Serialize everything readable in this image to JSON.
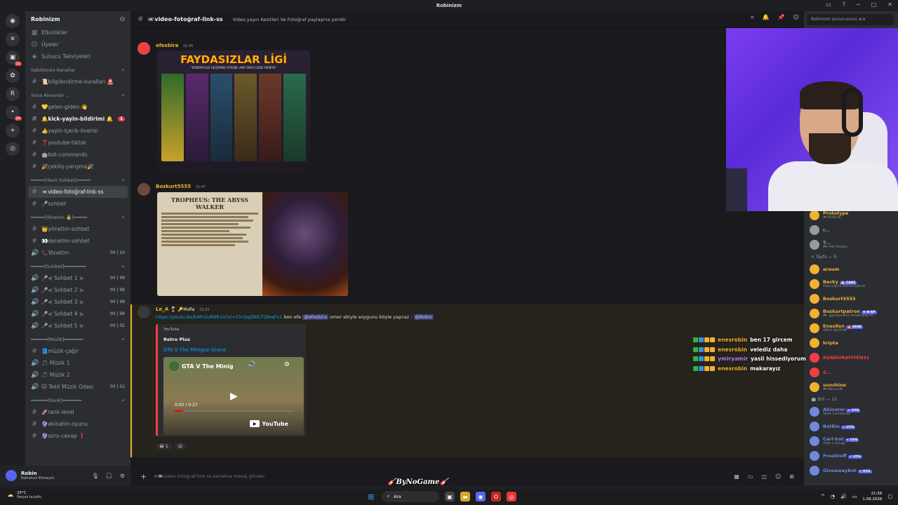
{
  "window": {
    "title": "Robinizm"
  },
  "servers": [
    {
      "icon": "discord-home-icon",
      "glyph": "◉"
    },
    {
      "icon": "server-x-icon",
      "glyph": "✕",
      "badge": ""
    },
    {
      "icon": "server-1-icon",
      "glyph": "▣",
      "badge": "11"
    },
    {
      "icon": "server-2-icon",
      "glyph": "✿",
      "badge": ""
    },
    {
      "icon": "server-robinizm-icon",
      "glyph": "R",
      "badge": ""
    },
    {
      "icon": "server-3-icon",
      "glyph": "•",
      "badge": "24"
    },
    {
      "icon": "add-server-icon",
      "glyph": "+"
    },
    {
      "icon": "explore-icon",
      "glyph": "◎"
    }
  ],
  "guild": {
    "name": "Robinizm",
    "chevron": "⌄"
  },
  "channel_top": [
    {
      "label": "Etkinlikler",
      "icon": "calendar-icon",
      "glyph": "▦"
    },
    {
      "label": "Üyeler",
      "icon": "members-icon",
      "glyph": "☺"
    },
    {
      "label": "Sunucu Takviyeleri",
      "icon": "boost-icon",
      "glyph": "◈"
    }
  ],
  "categories": {
    "pinned": "Sabitlenen Kanallar",
    "recent": "Sona Alınanlar ⌄",
    "text": "━━━━━[Yazılı Sohbet]━━━━━",
    "admin": "━━━━━[Yönetim 🔒]━━━━━",
    "chat": "━━━━━[Sohbet]━━━━━━━━",
    "music": "━━━━━━[Müzik]━━━━━━━",
    "rank": "━━━━━━[Rank]━━━━━━━"
  },
  "channels": {
    "pinned": [
      {
        "label": "📜bilgilendirme-kuralları 🚨",
        "type": "#"
      }
    ],
    "recent": [
      {
        "label": "💛gelen-giden-👋",
        "type": "#"
      },
      {
        "label": "🔔kick-yayin-bildirimi 🔔",
        "type": "#",
        "bold": true,
        "badge": "1"
      },
      {
        "label": "👍yayin-içerik-önerisi",
        "type": "#"
      },
      {
        "label": "❓youtube-tiktok",
        "type": "#"
      },
      {
        "label": "🤖bot-commands",
        "type": "#"
      },
      {
        "label": "🎉çekiliş-yarışma🎉",
        "type": "#"
      }
    ],
    "text": [
      {
        "label": "📼video-fotoğraf-link-ss",
        "type": "#",
        "active": true
      },
      {
        "label": "🎤sohbet",
        "type": "#"
      }
    ],
    "admin": [
      {
        "label": "👑yönetim-sohbet",
        "type": "#"
      },
      {
        "label": "👀denetim-sohbet",
        "type": "#"
      },
      {
        "label": "📞Yönetim",
        "type": "🔊",
        "rt": "00 | 10"
      }
    ],
    "chat": [
      {
        "label": "🎤⋞ Sohbet 1 ⋟",
        "type": "🔊",
        "rt": "00 | 99"
      },
      {
        "label": "🎤⋞ Sohbet 2 ⋟",
        "type": "🔊",
        "rt": "00 | 99"
      },
      {
        "label": "🎤⋞ Sohbet 3 ⋟",
        "type": "🔊",
        "rt": "00 | 99"
      },
      {
        "label": "🎤⋞ Sohbet 4 ⋟",
        "type": "🔊",
        "rt": "00 | 99"
      },
      {
        "label": "🎤⋞ Sohbet 5 ⋟",
        "type": "🔊",
        "rt": "00 | 02"
      }
    ],
    "music": [
      {
        "label": "📘müzik-çağır",
        "type": "#"
      },
      {
        "label": "🎵 Müzik 1",
        "type": "🔊"
      },
      {
        "label": "🎵 Müzik 2",
        "type": "🔊"
      },
      {
        "label": "🐱 Tekli Müzik Odası",
        "type": "🔊",
        "rt": "00 | 01"
      }
    ],
    "rank": [
      {
        "label": "🚀rank-level",
        "type": "#"
      },
      {
        "label": "🔮akinatör-oyunu",
        "type": "#"
      },
      {
        "label": "🔮soru-cevap ❗",
        "type": "#"
      }
    ]
  },
  "user": {
    "name": "Robin",
    "status": "Rahatsız Etmeyin"
  },
  "header": {
    "channel": "📼video-fotoğraf-link-ss",
    "topic": "Video,yayın Kesitleri Ve Fotoğraf paylaşma yeridir",
    "search_placeholder": "Robinizm sunucusunu ara"
  },
  "messages": [
    {
      "author": "efesbira",
      "time": "21:45",
      "color": "#f0b232",
      "image_title": "FAYDASIZLAR LİGİ",
      "image_sub": "\"DÜNYAYI ELE GEÇİRMEK İSTEDİK, AMA ÖNCE EVDE YEMEYE\""
    },
    {
      "author": "Bozkurt5555",
      "time": "21:47",
      "color": "#f0b232",
      "doc_title": "TROPHEUS: THE ABYSS WALKER"
    },
    {
      "author": "Le_A 🍷",
      "tag": "🔑Mafia",
      "time": "21:51",
      "color": "#f0b232",
      "link": "https://youtu.be/EAFr2uRNR1U?si=15rQqZNlCTQRwFx1",
      "text1": "ben efe",
      "mention1": "@efesbira",
      "text2": "omer abiyle soygunu böyle yapcaz :",
      "mention2": "@Robin",
      "embed": {
        "provider": "YouTube",
        "author": "Retro Plus",
        "title": "GTA V The Minigun Scene",
        "video_title": "GTA V The Minig",
        "time": "0:02 / 0:27",
        "yt": "YouTube"
      },
      "reaction_count": "1"
    }
  ],
  "composer": {
    "placeholder": "#📼video-fotoğraf-link-ss kanalına mesaj gönder"
  },
  "members": {
    "top": [
      {
        "name": "Prototype",
        "sub": "🎮 ROBLOX",
        "color": "#f0b232"
      },
      {
        "name": "r...",
        "sub": "",
        "color": "#949ba4"
      },
      {
        "name": "T...",
        "sub": "🎮 I'Am Tranbo...",
        "color": "#949ba4"
      }
    ],
    "tayfa_header": "✕ Tayfa — 9",
    "tayfa": [
      {
        "name": "areum",
        "sub": "",
        "color": "#f0b232"
      },
      {
        "name": "Becky",
        "tag": "🎂 CAKE",
        "sub": "https://guns.lol/conceptual",
        "color": "#f0b232"
      },
      {
        "name": "Bozkurt5555",
        "sub": "",
        "color": "#f0b232"
      },
      {
        "name": "Bozkurtpatron",
        "tag": "✖ N-RP",
        "sub": "🎮 .gg/newsanta /reddit-Ship Ai...",
        "color": "#f0b232"
      },
      {
        "name": "Enesðen",
        "tag": "🔥 SENE",
        "sub": "AMCA OLUYOM",
        "color": "#f0b232"
      },
      {
        "name": "kripta",
        "sub": "",
        "color": "#f0b232"
      },
      {
        "name": "KUNDURAYİYEN31",
        "sub": "",
        "color": "#f23f43"
      },
      {
        "name": "S...",
        "sub": "",
        "color": "#f23f43"
      },
      {
        "name": "sunshine",
        "sub": "🎮 Minecraft",
        "color": "#f0b232"
      }
    ],
    "bot_header": "🤖 Bot — 12",
    "bots": [
      {
        "name": "Akinator",
        "tag": "✔ UYG",
        "sub": "Slash Commands",
        "color": "#7289da"
      },
      {
        "name": "BotRix",
        "tag": "✔ UYG",
        "sub": "",
        "color": "#7289da"
      },
      {
        "name": "Carl-bot",
        "tag": "✔ UYG",
        "sub": "/help | carl.gg",
        "color": "#7289da"
      },
      {
        "name": "FreeStuff",
        "tag": "✔ UYG",
        "sub": "",
        "color": "#7289da"
      },
      {
        "name": "GiveawayBot",
        "tag": "✔ UYG",
        "sub": "",
        "color": "#7289da"
      }
    ]
  },
  "stream_chat": [
    {
      "user": "enesrobin",
      "text": "ben 17 gircem",
      "color": "#f0b232"
    },
    {
      "user": "enesrobin",
      "text": "velediz daha",
      "color": "#f0b232"
    },
    {
      "user": "ymiryamir",
      "text": "yasli hissediyorum",
      "color": "#b980ff"
    },
    {
      "user": "enesrobin",
      "text": "makarayız",
      "color": "#f0b232"
    }
  ],
  "watermark": "🎸ByNoGame🎸",
  "taskbar": {
    "temp": "25°C",
    "weather": "Parçalı bulutlu",
    "search": "Ara",
    "time": "21:56",
    "date": "1.08.2026"
  }
}
